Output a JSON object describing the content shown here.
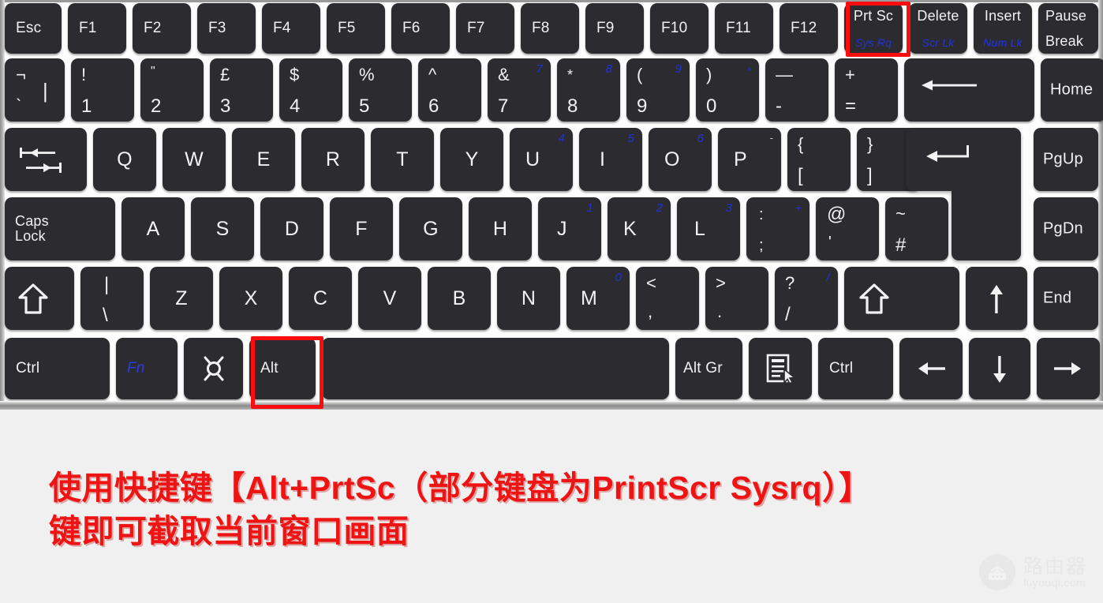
{
  "caption": {
    "line1": "使用快捷键【Alt+PrtSc（部分键盘为PrintScr Sysrq）】",
    "line2": "键即可截取当前窗口画面"
  },
  "watermark": {
    "cn": "路由器",
    "en": "luyouqi.com",
    "icon": "router-icon"
  },
  "colors": {
    "key_face": "#2b2b30",
    "key_label": "#f2f2f2",
    "fn_blue": "#2233dd",
    "highlight_red": "#fb0d0d",
    "caption_red": "#ef1414",
    "caption_bg": "#f0f0f0",
    "keyboard_bg": "#fdfdfd"
  },
  "highlights": [
    {
      "name": "prtsc-highlight",
      "key": "Prt Sc"
    },
    {
      "name": "alt-highlight",
      "key": "Alt"
    }
  ],
  "keyboard": {
    "layout": "UK laptop keyboard",
    "rows": [
      {
        "name": "function-row",
        "keys": [
          {
            "label": "Esc",
            "style": "left"
          },
          {
            "label": "F1"
          },
          {
            "label": "F2"
          },
          {
            "label": "F3"
          },
          {
            "label": "F4"
          },
          {
            "label": "F5"
          },
          {
            "label": "F6"
          },
          {
            "label": "F7"
          },
          {
            "label": "F8"
          },
          {
            "label": "F9"
          },
          {
            "label": "F10"
          },
          {
            "label": "F11"
          },
          {
            "label": "F12"
          },
          {
            "label": "Prt Sc",
            "sub": "Sys Rq",
            "highlight": true
          },
          {
            "label": "Delete",
            "sub": "Scr Lk"
          },
          {
            "label": "Insert",
            "sub": "Num Lk"
          },
          {
            "label": "Pause",
            "label2": "Break"
          }
        ]
      },
      {
        "name": "number-row",
        "keys": [
          {
            "upper": "¬",
            "lower": "`",
            "extra": "|"
          },
          {
            "upper": "!",
            "lower": "1"
          },
          {
            "upper": "\"",
            "lower": "2"
          },
          {
            "upper": "£",
            "lower": "3"
          },
          {
            "upper": "$",
            "lower": "4"
          },
          {
            "upper": "%",
            "lower": "5"
          },
          {
            "upper": "^",
            "lower": "6"
          },
          {
            "upper": "&",
            "lower": "7",
            "blue": "7"
          },
          {
            "upper": "*",
            "lower": "8",
            "blue": "8"
          },
          {
            "upper": "(",
            "lower": "9",
            "blue": "9"
          },
          {
            "upper": ")",
            "lower": "0",
            "blue": "*"
          },
          {
            "upper": "—",
            "lower": "-"
          },
          {
            "upper": "+",
            "lower": "="
          },
          {
            "label": "backspace-arrow",
            "icon": "backspace-icon"
          },
          {
            "label": "Home"
          }
        ]
      },
      {
        "name": "qwerty-row",
        "keys": [
          {
            "label": "tab",
            "icon": "tab-icon"
          },
          {
            "label": "Q"
          },
          {
            "label": "W"
          },
          {
            "label": "E"
          },
          {
            "label": "R"
          },
          {
            "label": "T"
          },
          {
            "label": "Y"
          },
          {
            "label": "U",
            "blue": "4"
          },
          {
            "label": "I",
            "blue": "5"
          },
          {
            "label": "O",
            "blue": "6"
          },
          {
            "label": "P",
            "blue": "-"
          },
          {
            "upper": "{",
            "lower": "["
          },
          {
            "upper": "}",
            "lower": "]"
          },
          {
            "label": "enter",
            "icon": "enter-icon"
          },
          {
            "label": "PgUp"
          }
        ]
      },
      {
        "name": "home-row",
        "keys": [
          {
            "label": "Caps",
            "label2": "Lock"
          },
          {
            "label": "A"
          },
          {
            "label": "S"
          },
          {
            "label": "D"
          },
          {
            "label": "F"
          },
          {
            "label": "G"
          },
          {
            "label": "H"
          },
          {
            "label": "J",
            "blue": "1"
          },
          {
            "label": "K",
            "blue": "2"
          },
          {
            "label": "L",
            "blue": "3"
          },
          {
            "upper": ":",
            "lower": ";",
            "blue": "+"
          },
          {
            "upper": "@",
            "lower": "'"
          },
          {
            "upper": "~",
            "lower": "#"
          },
          {
            "label": "PgDn"
          }
        ]
      },
      {
        "name": "shift-row",
        "keys": [
          {
            "label": "shift-left",
            "icon": "shift-icon"
          },
          {
            "upper": "|",
            "lower": "\\"
          },
          {
            "label": "Z"
          },
          {
            "label": "X"
          },
          {
            "label": "C"
          },
          {
            "label": "V"
          },
          {
            "label": "B"
          },
          {
            "label": "N"
          },
          {
            "label": "M",
            "blue": "0"
          },
          {
            "upper": "<",
            "lower": ","
          },
          {
            "upper": ">",
            "lower": "."
          },
          {
            "upper": "?",
            "lower": "/",
            "blue": "/"
          },
          {
            "label": "shift-right",
            "icon": "shift-icon"
          },
          {
            "label": "arrow-up",
            "icon": "arrow-up-icon"
          },
          {
            "label": "End"
          }
        ]
      },
      {
        "name": "bottom-row",
        "keys": [
          {
            "label": "Ctrl"
          },
          {
            "label": "Fn",
            "blue_label": true
          },
          {
            "label": "windows",
            "icon": "windows-icon"
          },
          {
            "label": "Alt",
            "highlight": true
          },
          {
            "label": "space",
            "icon": "spacebar"
          },
          {
            "label": "Alt Gr"
          },
          {
            "label": "menu",
            "icon": "context-menu-icon"
          },
          {
            "label": "Ctrl"
          },
          {
            "label": "arrow-left",
            "icon": "arrow-left-icon"
          },
          {
            "label": "arrow-down",
            "icon": "arrow-down-icon"
          },
          {
            "label": "arrow-right",
            "icon": "arrow-right-icon"
          }
        ]
      }
    ]
  }
}
